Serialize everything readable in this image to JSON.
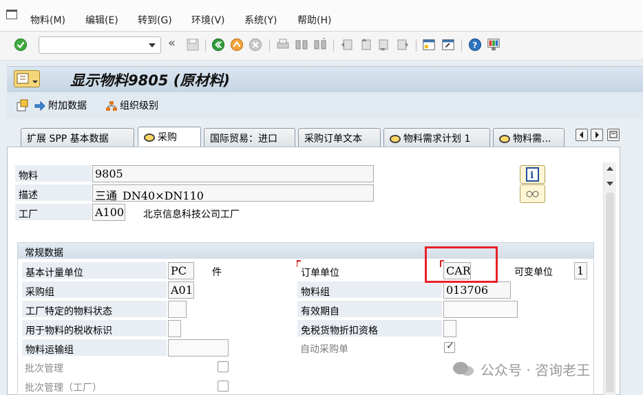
{
  "menubar": {
    "items": [
      "物料(M)",
      "编辑(E)",
      "转到(G)",
      "环境(V)",
      "系统(Y)",
      "帮助(H)"
    ]
  },
  "toolbar": {
    "command_field_value": "",
    "icons": [
      "enter-icon",
      "back-icon",
      "exit-icon",
      "cancel-icon",
      "print-icon",
      "find-icon",
      "find-next-icon",
      "first-page-icon",
      "prev-page-icon",
      "next-page-icon",
      "last-page-icon",
      "new-session-icon",
      "shortcut-icon",
      "help-icon",
      "layout-icon"
    ]
  },
  "title": {
    "text": "显示物料9805 (原材料)"
  },
  "appbar": {
    "additional_data": "附加数据",
    "org_levels": "组织级别"
  },
  "tabs": [
    {
      "label": "扩展 SPP 基本数据",
      "active": false
    },
    {
      "label": "采购",
      "active": true
    },
    {
      "label": "国际贸易：进口",
      "active": false
    },
    {
      "label": "采购订单文本",
      "active": false
    },
    {
      "label": "物料需求计划 1",
      "active": false
    },
    {
      "label": "物料需...",
      "active": false
    }
  ],
  "header": {
    "material_label": "物料",
    "material_value": "9805",
    "description_label": "描述",
    "description_value": "三通_DN40×DN110",
    "plant_label": "工厂",
    "plant_value": "A100",
    "plant_name": "北京信息科技公司工厂"
  },
  "general": {
    "title": "常规数据",
    "base_uom_label": "基本计量单位",
    "base_uom_value": "PC",
    "base_uom_text": "件",
    "order_unit_label": "订单单位",
    "order_unit_value": "CAR",
    "variable_unit_label": "可变单位",
    "variable_unit_value": "1",
    "purch_group_label": "采购组",
    "purch_group_value": "A01",
    "material_group_label": "物料组",
    "material_group_value": "013706",
    "plant_status_label": "工厂特定的物料状态",
    "plant_status_value": "",
    "valid_from_label": "有效期自",
    "valid_from_value": "",
    "tax_label": "用于物料的税收标识",
    "tax_value": "",
    "tax_exempt_label": "免税货物折扣资格",
    "tax_exempt_value": "",
    "transport_label": "物料运输组",
    "transport_value": "",
    "auto_po_label": "自动采购单",
    "auto_po_checked": true,
    "batch_label": "批次管理",
    "batch_checked": false,
    "batch_plant_label": "批次管理（工厂）",
    "batch_plant_checked": false
  },
  "watermark": "公众号 · 咨询老王",
  "colors": {
    "highlight": "#e8202a",
    "title_bg": "#c6d5e4",
    "label_bg": "#e9eef4"
  }
}
